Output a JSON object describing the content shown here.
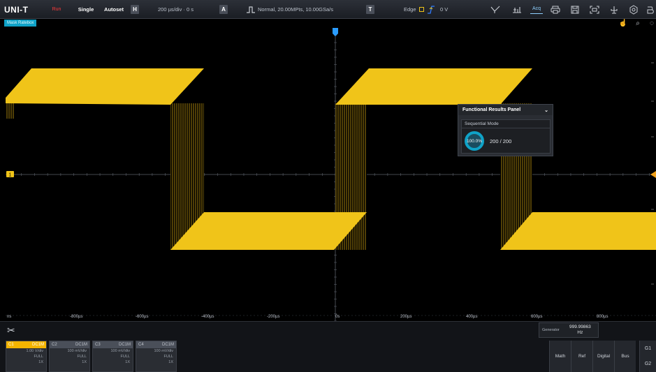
{
  "toolbar": {
    "logo": "UNI-T",
    "run_label": "Run",
    "single_label": "Single",
    "autoset_label": "Autoset",
    "h_label": "H",
    "timebase": "200 µs/div · 0 s",
    "a_label": "A",
    "acquisition": "Normal, 20.00MPts, 10.00GSa/s",
    "t_label": "T",
    "trigger_type": "Edge",
    "trigger_level": "0 V",
    "acq_mode_label": "Acq",
    "icons": [
      "cursor-icon",
      "measure-icon",
      "acq-icon",
      "print-icon",
      "save-icon",
      "screenshot-icon",
      "usb-icon",
      "settings-icon",
      "menu-icon"
    ]
  },
  "mode_badge": "Mask Ratebox",
  "waveform": {
    "channel_marker": "1",
    "channel_color": "#f0c419",
    "x_ticks": [
      "ns",
      "-800µs",
      "-600µs",
      "-400µs",
      "-200µs",
      "0s",
      "200µs",
      "400µs",
      "600µs",
      "800µs"
    ],
    "timebase_per_div_us": 200
  },
  "results_panel": {
    "title": "Functional Results Panel",
    "mode": "Sequential Mode",
    "percent": "100.0%",
    "count": "200 / 200"
  },
  "counter": {
    "label": "Generator",
    "value": "999.99863",
    "unit": "Hz"
  },
  "channels": [
    {
      "name": "C1",
      "coupling": "DC1M",
      "scale": "1.00 V/div",
      "bw": "FULL",
      "extra": "1X",
      "active": true
    },
    {
      "name": "C2",
      "coupling": "DC1M",
      "scale": "100 mV/div",
      "bw": "FULL",
      "extra": "1X",
      "active": false
    },
    {
      "name": "C3",
      "coupling": "DC1M",
      "scale": "100 mV/div",
      "bw": "FULL",
      "extra": "1X",
      "active": false
    },
    {
      "name": "C4",
      "coupling": "DC1M",
      "scale": "100 mV/div",
      "bw": "FULL",
      "extra": "1X",
      "active": false
    }
  ],
  "side_buttons": [
    "Math",
    "Ref",
    "Digital",
    "Bus"
  ],
  "g_buttons": [
    "G1",
    "G2"
  ]
}
